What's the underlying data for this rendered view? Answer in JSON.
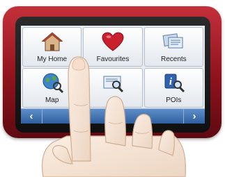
{
  "menu": {
    "tiles": [
      {
        "label": "My Home",
        "icon": "house-icon"
      },
      {
        "label": "Favourites",
        "icon": "heart-icon"
      },
      {
        "label": "Recents",
        "icon": "documents-icon"
      },
      {
        "label": "Map",
        "icon": "globe-magnifier-icon"
      },
      {
        "label": "",
        "icon": "search-document-icon"
      },
      {
        "label": "POIs",
        "icon": "info-magnifier-icon"
      }
    ]
  },
  "nav": {
    "prev_icon": "chevron-left-icon",
    "next_icon": "chevron-right-icon",
    "prev_glyph": "‹",
    "next_glyph": "›"
  },
  "colors": {
    "device_body": "#a51c26",
    "nav_bar": "#3d6daf",
    "heart": "#c8202d"
  }
}
